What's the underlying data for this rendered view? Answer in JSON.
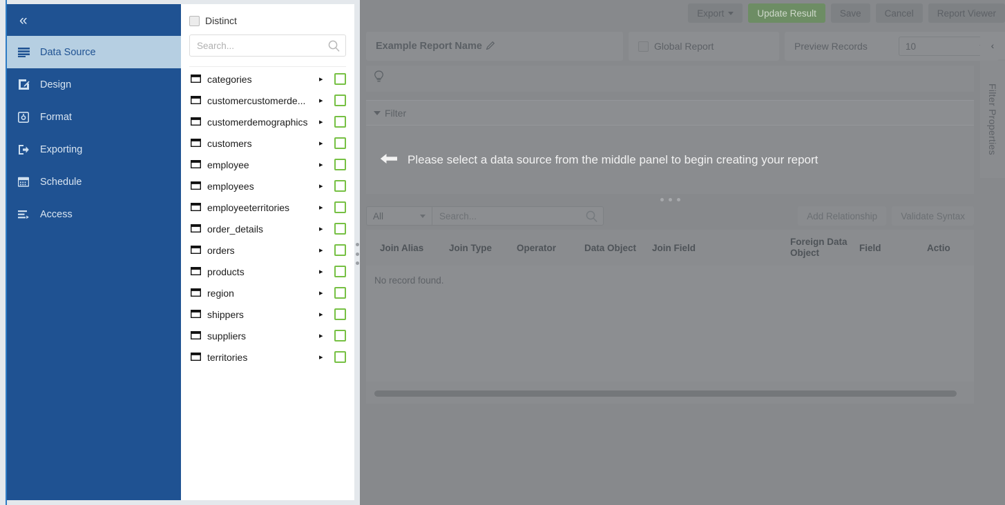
{
  "sidebar": {
    "collapse_label": "«",
    "items": [
      {
        "label": "Data Source",
        "icon": "list-icon",
        "active": true
      },
      {
        "label": "Design",
        "icon": "pencil-square-icon",
        "active": false
      },
      {
        "label": "Format",
        "icon": "format-gear-icon",
        "active": false
      },
      {
        "label": "Exporting",
        "icon": "export-icon",
        "active": false
      },
      {
        "label": "Schedule",
        "icon": "calendar-icon",
        "active": false
      },
      {
        "label": "Access",
        "icon": "access-list-icon",
        "active": false
      }
    ]
  },
  "middle_panel": {
    "distinct_label": "Distinct",
    "search_placeholder": "Search...",
    "tables": [
      {
        "name": "categories"
      },
      {
        "name": "customercustomerde..."
      },
      {
        "name": "customerdemographics"
      },
      {
        "name": "customers"
      },
      {
        "name": "employee"
      },
      {
        "name": "employees"
      },
      {
        "name": "employeeterritories"
      },
      {
        "name": "order_details"
      },
      {
        "name": "orders"
      },
      {
        "name": "products"
      },
      {
        "name": "region"
      },
      {
        "name": "shippers"
      },
      {
        "name": "suppliers"
      },
      {
        "name": "territories"
      }
    ]
  },
  "toolbar": {
    "export_label": "Export",
    "update_result_label": "Update Result",
    "save_label": "Save",
    "cancel_label": "Cancel",
    "report_viewer_label": "Report Viewer"
  },
  "report_row": {
    "report_name": "Example Report Name",
    "global_report_label": "Global Report",
    "preview_records_label": "Preview Records",
    "preview_records_value": "10"
  },
  "filter_section": {
    "filter_label": "Filter",
    "hint_message": "Please select a data source from the middle panel to begin creating your report"
  },
  "relationship": {
    "scope_value": "All",
    "search_placeholder": "Search...",
    "add_relationship_label": "Add Relationship",
    "validate_syntax_label": "Validate Syntax",
    "columns": [
      "Join Alias",
      "Join Type",
      "Operator",
      "Data Object",
      "Join Field",
      "Foreign Data Object",
      "Field",
      "Actio"
    ],
    "empty_message": "No record found."
  },
  "right_rail": {
    "collapse_icon": "‹",
    "tab_label": "Filter Properties"
  },
  "colors": {
    "sidebar_bg": "#1f5292",
    "sidebar_active_bg": "#b6cfe2",
    "accent_blue": "#2e7bc4",
    "checkbox_green": "#76c043",
    "primary_button_green": "#6d8d64",
    "overlay_gray": "#87898c",
    "page_bg": "#e4e8ec"
  }
}
